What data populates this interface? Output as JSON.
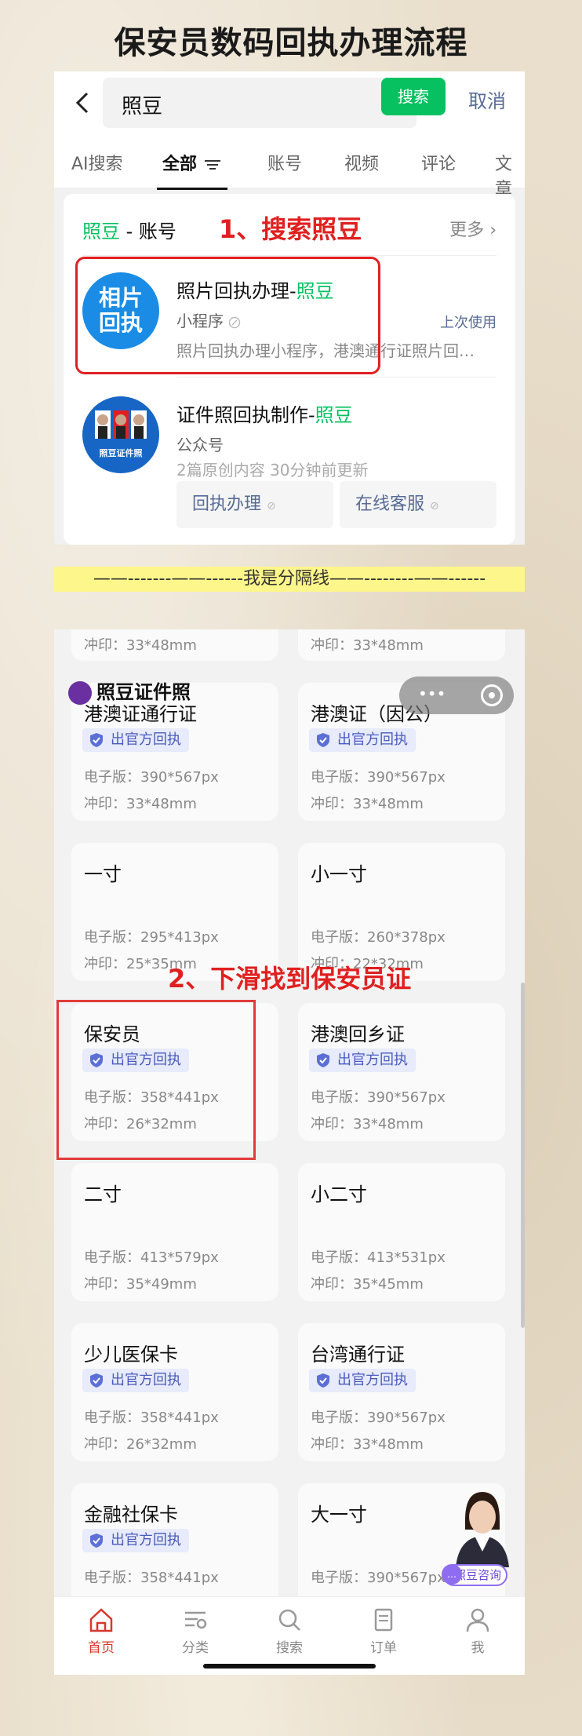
{
  "page_title": "保安员数码回执办理流程",
  "panel1": {
    "search": {
      "query": "照豆",
      "button": "搜索",
      "cancel": "取消"
    },
    "tabs": [
      "AI搜索",
      "全部",
      "账号",
      "视频",
      "评论",
      "文章"
    ],
    "section": {
      "highlight": "照豆",
      "suffix": " - 账号",
      "more": "更多"
    },
    "annotation": "1、搜索照豆",
    "results": [
      {
        "logo_line1": "相片",
        "logo_line2": "回执",
        "title_prefix": "照片回执办理-",
        "title_highlight": "照豆",
        "type": "小程序",
        "badge": "上次使用",
        "desc": "照片回执办理小程序，港澳通行证照片回…"
      },
      {
        "logo_text": "照豆证件照",
        "title_prefix": "证件照回执制作-",
        "title_highlight": "照豆",
        "type": "公众号",
        "desc": "2篇原创内容  30分钟前更新",
        "buttons": [
          "回执办理",
          "在线客服"
        ]
      }
    ]
  },
  "separator": "——-------——------我是分隔线——--------——------",
  "panel2": {
    "brand": "照豆证件照",
    "annotation": "2、下滑找到保安员证",
    "badge_text": "出官方回执",
    "top_partial": [
      "冲印：33*48mm",
      "冲印：33*48mm"
    ],
    "cards": [
      {
        "title": "港澳证通行证",
        "badge": true,
        "digital": "电子版：390*567px",
        "print": "冲印：33*48mm"
      },
      {
        "title": "港澳证（因公）",
        "badge": true,
        "digital": "电子版：390*567px",
        "print": "冲印：33*48mm"
      },
      {
        "title": "一寸",
        "badge": false,
        "digital": "电子版：295*413px",
        "print": "冲印：25*35mm"
      },
      {
        "title": "小一寸",
        "badge": false,
        "digital": "电子版：260*378px",
        "print": "冲印：22*32mm"
      },
      {
        "title": "保安员",
        "badge": true,
        "digital": "电子版：358*441px",
        "print": "冲印：26*32mm"
      },
      {
        "title": "港澳回乡证",
        "badge": true,
        "digital": "电子版：390*567px",
        "print": "冲印：33*48mm"
      },
      {
        "title": "二寸",
        "badge": false,
        "digital": "电子版：413*579px",
        "print": "冲印：35*49mm"
      },
      {
        "title": "小二寸",
        "badge": false,
        "digital": "电子版：413*531px",
        "print": "冲印：35*45mm"
      },
      {
        "title": "少儿医保卡",
        "badge": true,
        "digital": "电子版：358*441px",
        "print": "冲印：26*32mm"
      },
      {
        "title": "台湾通行证",
        "badge": true,
        "digital": "电子版：390*567px",
        "print": "冲印：33*48mm"
      },
      {
        "title": "金融社保卡",
        "badge": true,
        "digital": "电子版：358*441px",
        "print": ""
      },
      {
        "title": "大一寸",
        "badge": false,
        "digital": "电子版：390*567px",
        "print": ""
      }
    ],
    "consult_label": "照豆咨询",
    "nav": [
      "首页",
      "分类",
      "搜索",
      "订单",
      "我"
    ]
  },
  "colors": {
    "wechat_green": "#07c160",
    "link_blue": "#576b95",
    "annotation_red": "#e02020",
    "badge_bg": "#e7ebfb",
    "nav_active": "#d9362b",
    "separator_yellow": "#fdf68a"
  }
}
